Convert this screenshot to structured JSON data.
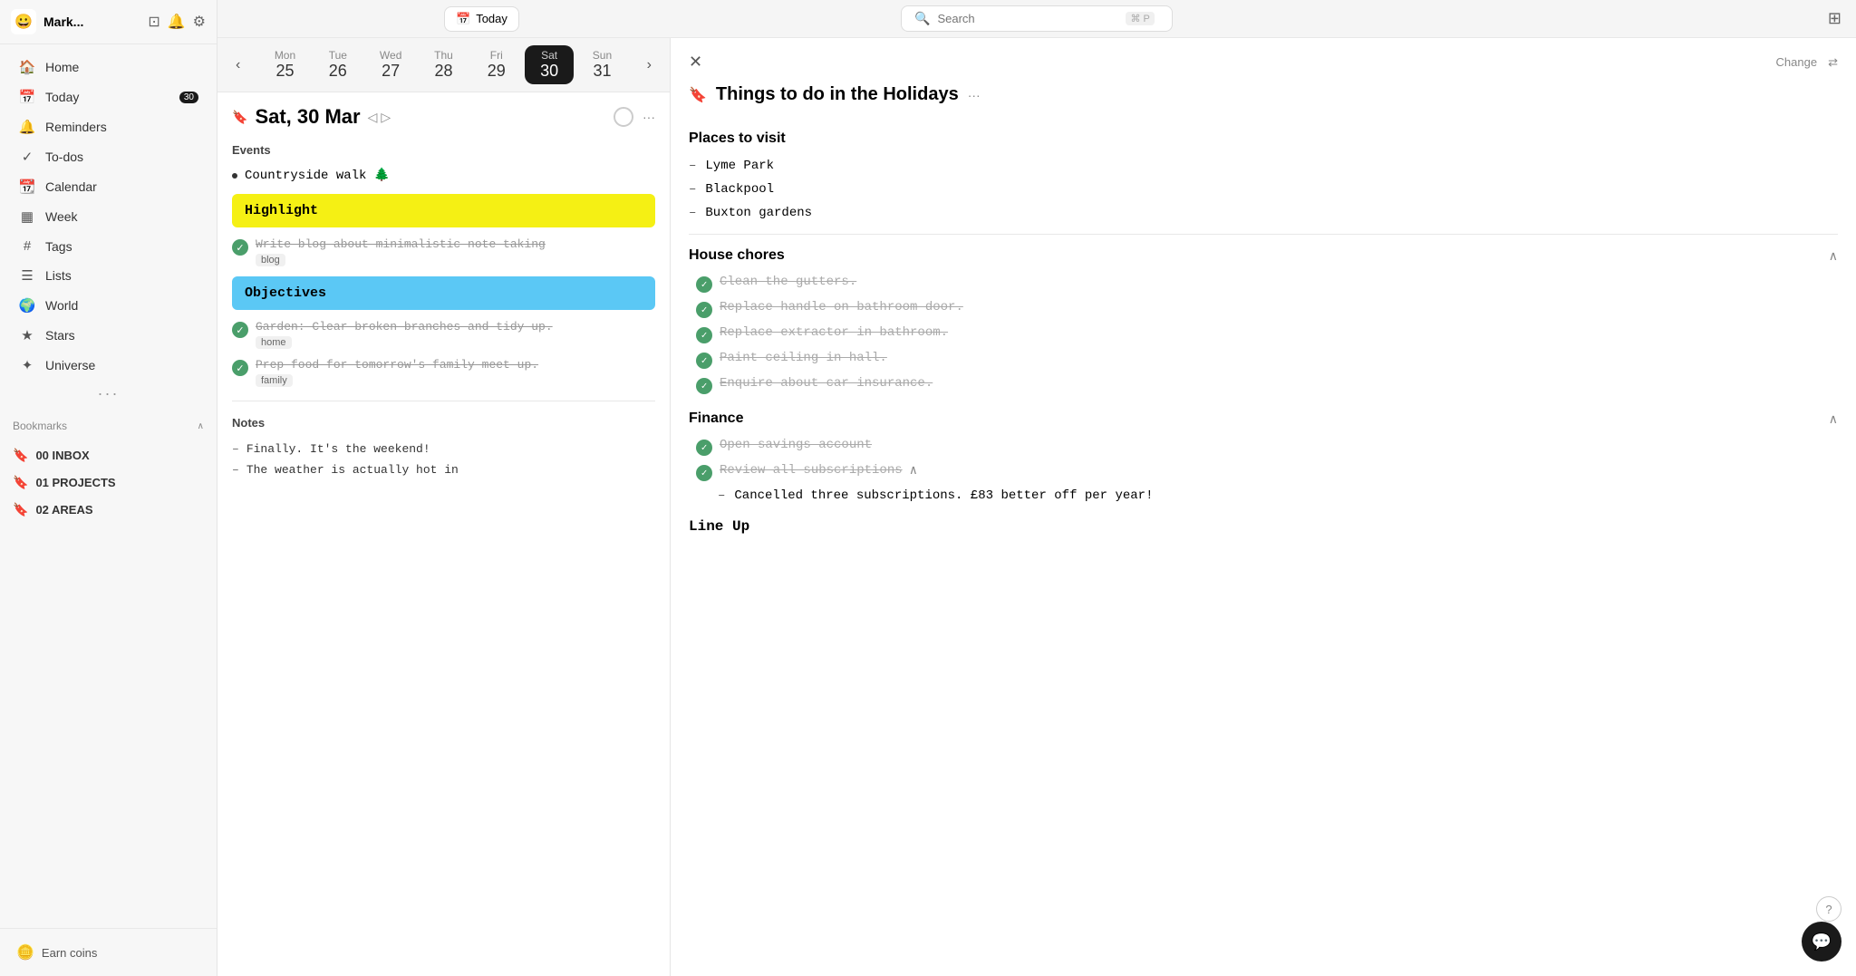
{
  "app": {
    "title": "Mark...",
    "icon": "😀"
  },
  "topbar": {
    "today_label": "Today",
    "search_placeholder": "Search",
    "search_shortcut": "⌘ P"
  },
  "sidebar": {
    "nav_items": [
      {
        "id": "home",
        "icon": "🏠",
        "label": "Home"
      },
      {
        "id": "today",
        "icon": "📅",
        "label": "Today",
        "badge": "30"
      },
      {
        "id": "reminders",
        "icon": "🔔",
        "label": "Reminders"
      },
      {
        "id": "todos",
        "icon": "✓",
        "label": "To-dos"
      },
      {
        "id": "calendar",
        "icon": "📆",
        "label": "Calendar"
      },
      {
        "id": "week",
        "icon": "▦",
        "label": "Week"
      },
      {
        "id": "tags",
        "icon": "#",
        "label": "Tags"
      },
      {
        "id": "lists",
        "icon": "☰",
        "label": "Lists"
      },
      {
        "id": "world",
        "icon": "🌍",
        "label": "World"
      },
      {
        "id": "stars",
        "icon": "★",
        "label": "Stars"
      },
      {
        "id": "universe",
        "icon": "✦",
        "label": "Universe"
      }
    ],
    "bookmarks_label": "Bookmarks",
    "bookmarks": [
      {
        "id": "inbox",
        "icon": "🔖",
        "color": "#f5a623",
        "label": "00 INBOX"
      },
      {
        "id": "projects",
        "icon": "🔖",
        "color": "#f5a623",
        "label": "01 PROJECTS"
      },
      {
        "id": "areas",
        "icon": "🔖",
        "color": "#f5a623",
        "label": "02 AREAS"
      }
    ],
    "earn_coins_label": "Earn coins"
  },
  "week_days": [
    {
      "name": "Mon",
      "num": "25"
    },
    {
      "name": "Tue",
      "num": "26"
    },
    {
      "name": "Wed",
      "num": "27"
    },
    {
      "name": "Thu",
      "num": "28"
    },
    {
      "name": "Fri",
      "num": "29"
    },
    {
      "name": "Sat",
      "num": "30",
      "active": true
    },
    {
      "name": "Sun",
      "num": "31"
    }
  ],
  "day": {
    "title": "Sat, 30 Mar",
    "sections": {
      "events_label": "Events",
      "notes_label": "Notes"
    },
    "events": [
      {
        "label": "Countryside walk 🌲"
      }
    ],
    "highlight": "Highlight",
    "todos": [
      {
        "text": "Write blog about minimalistic note-taking",
        "tag": "blog",
        "done": true
      }
    ],
    "objectives": "Objectives",
    "objectives_todos": [
      {
        "text": "Garden: Clear broken branches and tidy up.",
        "tag": "home",
        "done": true
      },
      {
        "text": "Prep food for tomorrow's family meet up.",
        "tag": "family",
        "done": true
      }
    ],
    "notes": [
      {
        "text": "Finally. It's the weekend!"
      },
      {
        "text": "The weather is actually hot in"
      }
    ]
  },
  "detail": {
    "title": "Things to do in the Holidays",
    "change_label": "Change",
    "places_label": "Places to visit",
    "places": [
      {
        "text": "Lyme Park"
      },
      {
        "text": "Blackpool"
      },
      {
        "text": "Buxton gardens"
      }
    ],
    "house_chores_label": "House chores",
    "house_chores": [
      {
        "text": "Clean the gutters.",
        "done": true
      },
      {
        "text": "Replace handle on bathroom door.",
        "done": true
      },
      {
        "text": "Replace extractor in bathroom.",
        "done": true
      },
      {
        "text": "Paint ceiling in hall.",
        "done": true
      },
      {
        "text": "Enquire about car insurance.",
        "done": true
      }
    ],
    "finance_label": "Finance",
    "finance": [
      {
        "text": "Open savings account",
        "done": true
      },
      {
        "text": "Review all subscriptions",
        "done": true,
        "sub_items": [
          {
            "text": "Cancelled three subscriptions. £83 better off per year!"
          }
        ]
      }
    ],
    "line_up_label": "Line Up"
  }
}
